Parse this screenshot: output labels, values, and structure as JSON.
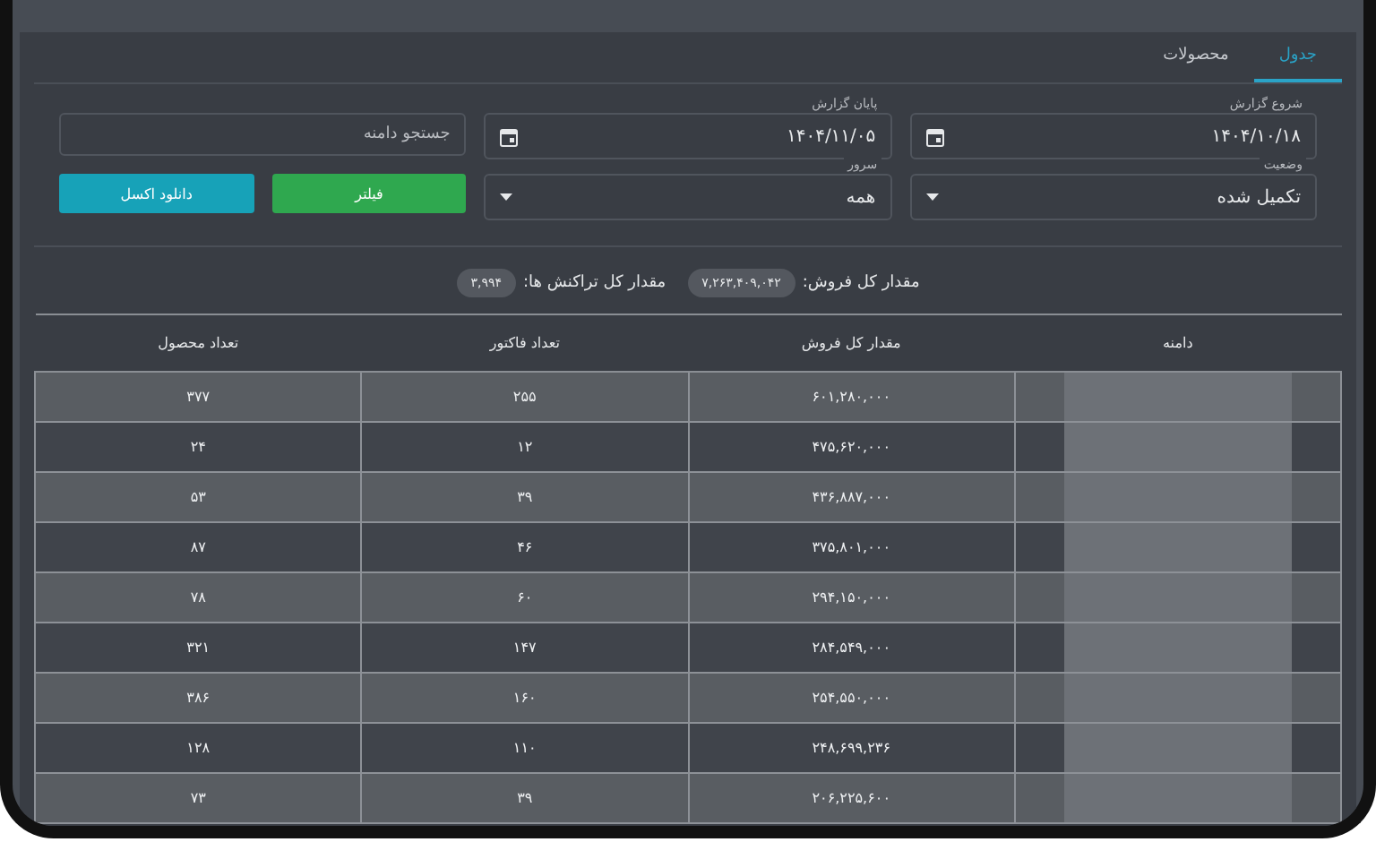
{
  "tabs": [
    {
      "label": "جدول",
      "selected": true
    },
    {
      "label": "محصولات",
      "selected": false
    }
  ],
  "filters": {
    "start": {
      "label": "شروع گزارش",
      "value": "۱۴۰۴/۱۰/۱۸"
    },
    "end": {
      "label": "پایان گزارش",
      "value": "۱۴۰۴/۱۱/۰۵"
    },
    "search": {
      "placeholder": "جستجو دامنه"
    },
    "status": {
      "label": "وضعیت",
      "value": "تکمیل شده"
    },
    "server": {
      "label": "سرور",
      "value": "همه"
    }
  },
  "buttons": [
    {
      "label": "فیلتر",
      "kind": "filter"
    },
    {
      "label": "دانلود اکسل",
      "kind": "export"
    }
  ],
  "summary": [
    {
      "label": "مقدار کل فروش:",
      "value": "۷,۲۶۳,۴۰۹,۰۴۲"
    },
    {
      "label": "مقدار کل تراکنش ها:",
      "value": "۳,۹۹۴"
    }
  ],
  "table": {
    "columns": [
      "دامنه",
      "مقدار کل فروش",
      "تعداد فاکتور",
      "تعداد محصول"
    ],
    "rows": [
      [
        "",
        "۶۰۱,۲۸۰,۰۰۰",
        "۲۵۵",
        "۳۷۷"
      ],
      [
        "",
        "۴۷۵,۶۲۰,۰۰۰",
        "۱۲",
        "۲۴"
      ],
      [
        "",
        "۴۳۶,۸۸۷,۰۰۰",
        "۳۹",
        "۵۳"
      ],
      [
        "",
        "۳۷۵,۸۰۱,۰۰۰",
        "۴۶",
        "۸۷"
      ],
      [
        "",
        "۲۹۴,۱۵۰,۰۰۰",
        "۶۰",
        "۷۸"
      ],
      [
        "",
        "۲۸۴,۵۴۹,۰۰۰",
        "۱۴۷",
        "۳۲۱"
      ],
      [
        "",
        "۲۵۴,۵۵۰,۰۰۰",
        "۱۶۰",
        "۳۸۶"
      ],
      [
        "",
        "۲۴۸,۶۹۹,۲۳۶",
        "۱۱۰",
        "۱۲۸"
      ],
      [
        "",
        "۲۰۶,۲۲۵,۶۰۰",
        "۳۹",
        "۷۳"
      ]
    ]
  }
}
